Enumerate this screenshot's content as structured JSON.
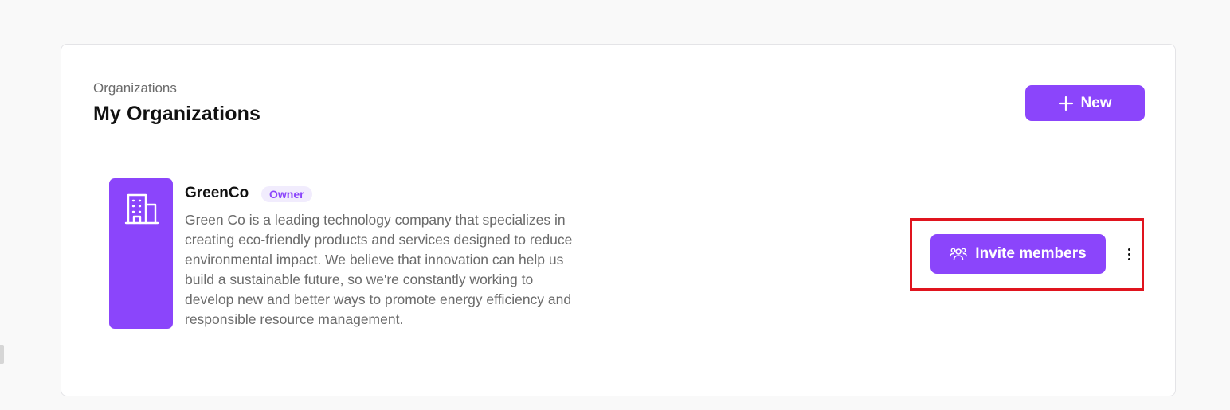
{
  "header": {
    "breadcrumb": "Organizations",
    "title": "My Organizations",
    "new_button_label": "New",
    "new_button_icon": "plus-icon"
  },
  "organizations": [
    {
      "name": "GreenCo",
      "role_badge": "Owner",
      "description": "Green Co is a leading technology company that specializes in creating eco-friendly products and services designed to reduce environmental impact. We believe that innovation can help us build a sustainable future, so we're constantly working to develop new and better ways to promote energy efficiency and responsible resource management.",
      "logo_icon": "building-icon",
      "invite_button_label": "Invite members",
      "invite_button_icon": "users-icon",
      "more_icon": "more-vertical-icon"
    }
  ],
  "colors": {
    "accent": "#8b45fb",
    "badge_bg": "#f1ecfd",
    "highlight": "#e0141e",
    "page_bg": "#f9f9f9",
    "card_bg": "#ffffff",
    "muted_text": "#6b6b6b"
  }
}
